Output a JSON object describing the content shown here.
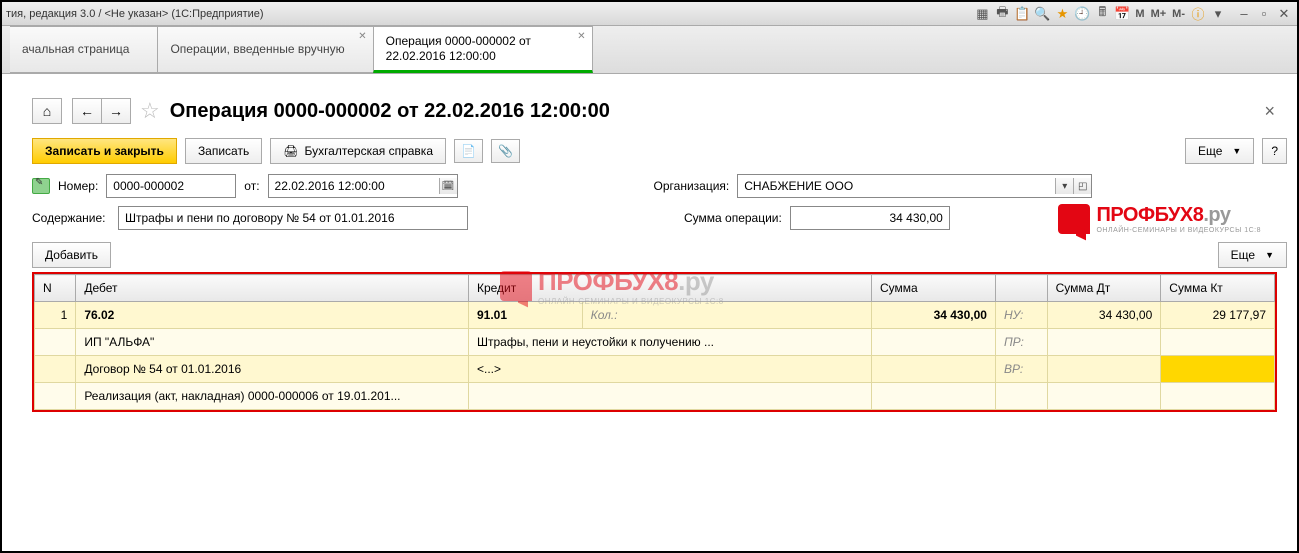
{
  "titlebar": "тия, редакция 3.0 / <Не указан>   (1С:Предприятие)",
  "tabs": {
    "t1": "ачальная страница",
    "t2": "Операции, введенные вручную",
    "t3": "Операция 0000-000002 от 22.02.2016 12:00:00"
  },
  "header": {
    "title": "Операция 0000-000002 от 22.02.2016 12:00:00"
  },
  "logo": {
    "brand1": "ПРОФБУХ8",
    "brand2": ".ру",
    "sub": "ОНЛАЙН-СЕМИНАРЫ И ВИДЕОКУРСЫ 1С:8"
  },
  "toolbar": {
    "save_close": "Записать и закрыть",
    "save": "Записать",
    "report": "Бухгалтерская справка",
    "more": "Еще"
  },
  "fields": {
    "number_label": "Номер:",
    "number": "0000-000002",
    "from_label": "от:",
    "date": "22.02.2016 12:00:00",
    "org_label": "Организация:",
    "org": "СНАБЖЕНИЕ ООО",
    "content_label": "Содержание:",
    "content": "Штрафы и пени по договору № 54 от 01.01.2016",
    "sum_label": "Сумма операции:",
    "sum": "34 430,00"
  },
  "gridbar": {
    "add": "Добавить",
    "more": "Еще"
  },
  "grid": {
    "h_n": "N",
    "h_debit": "Дебет",
    "h_credit": "Кредит",
    "h_sum": "Сумма",
    "h_sumdt": "Сумма Дт",
    "h_sumkt": "Сумма Кт",
    "row": {
      "n": "1",
      "debit": "76.02",
      "credit": "91.01",
      "kol": "Кол.:",
      "sum": "34 430,00",
      "nu": "НУ:",
      "sumdt": "34 430,00",
      "sumkt": "29 177,97",
      "d2": "ИП \"АЛЬФА\"",
      "c2": "Штрафы, пени и неустойки к получению ...",
      "pr": "ПР:",
      "d3": "Договор № 54 от 01.01.2016",
      "c3": "<...>",
      "vr": "ВР:",
      "d4": "Реализация (акт, накладная) 0000-000006 от 19.01.201..."
    }
  }
}
